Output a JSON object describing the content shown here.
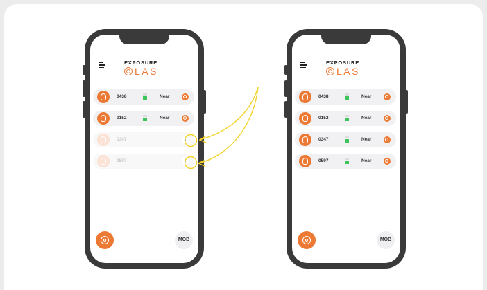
{
  "colors": {
    "accent": "#ec7a34",
    "signal": "#3ec45c",
    "callout": "#f2d228",
    "phone_frame": "#3a3a3a"
  },
  "logo": {
    "top": "EXPOSURE",
    "bottom": "LAS"
  },
  "icons": {
    "menu": "hamburger-icon",
    "logo_mark": "target-icon",
    "avatar": "watch-icon",
    "status": "target-icon",
    "fab": "target-icon"
  },
  "before": {
    "rows": [
      {
        "id": "0438",
        "proximity": "Near",
        "active": true
      },
      {
        "id": "0152",
        "proximity": "Near",
        "active": true
      },
      {
        "id": "0347",
        "proximity": "",
        "active": false
      },
      {
        "id": "0597",
        "proximity": "",
        "active": false
      }
    ],
    "mob_label": "MOB"
  },
  "after": {
    "rows": [
      {
        "id": "0438",
        "proximity": "Near",
        "active": true
      },
      {
        "id": "0152",
        "proximity": "Near",
        "active": true
      },
      {
        "id": "0347",
        "proximity": "Near",
        "active": true
      },
      {
        "id": "0597",
        "proximity": "Near",
        "active": true
      }
    ],
    "mob_label": "MOB"
  }
}
